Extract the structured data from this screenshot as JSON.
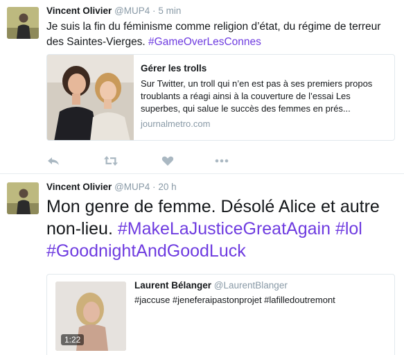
{
  "colors": {
    "hashtag": "#6e3be0",
    "muted": "#8899a6",
    "text": "#14171a",
    "border": "#e1e8ed"
  },
  "tweets": [
    {
      "author": "Vincent Olivier",
      "handle": "@MUP4",
      "separator": "·",
      "time": "5 min",
      "text_before": "Je suis la fin du féminisme comme religion d’état, du régime de terreur des Saintes-Vierges. ",
      "hashtag": "#GameOverLesConnes",
      "card": {
        "title": "Gérer les trolls",
        "description": "Sur Twitter, un troll qui n’en est pas à ses premiers propos troublants a réagi ainsi à la couverture de l’essai Les superbes, qui salue le succès des femmes en prés...",
        "domain": "journalmetro.com"
      },
      "actions": [
        "reply-icon",
        "retweet-icon",
        "like-icon",
        "more-icon"
      ]
    },
    {
      "author": "Vincent Olivier",
      "handle": "@MUP4",
      "separator": "·",
      "time": "20 h",
      "text_before": "Mon genre de femme. Désolé Alice et autre non-lieu. ",
      "hashtags": [
        "#MakeLaJusticeGreatAgain",
        "#lol",
        "#GoodnightAndGoodLuck"
      ],
      "quote": {
        "author": "Laurent Bélanger",
        "handle": "@LaurentBlanger",
        "text": "#jaccuse #jeneferaipastonprojet #lafilledoutremont",
        "duration": "1:22"
      }
    }
  ]
}
